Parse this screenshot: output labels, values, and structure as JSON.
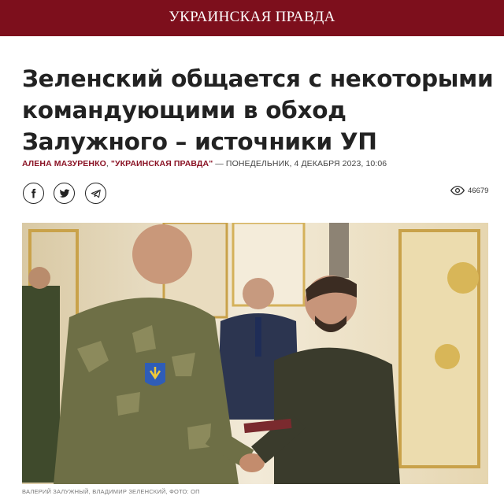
{
  "site": {
    "name": "УКРАИНСКАЯ ПРАВДА"
  },
  "article": {
    "title": "Зеленский общается с некоторыми командующими в обход Залужного – источники УП",
    "author": "АЛЕНА МАЗУРЕНКО",
    "source": "\"УКРАИНСКАЯ ПРАВДА\"",
    "separator": " — ",
    "date": "ПОНЕДЕЛЬНИК, 4 ДЕКАБРЯ 2023, 10:06",
    "views": "46679",
    "photo_caption": "ВАЛЕРИЙ ЗАЛУЖНЫЙ, ВЛАДИМИР ЗЕЛЕНСКИЙ, ФОТО: ОП"
  },
  "share": {
    "icons": [
      "facebook-icon",
      "twitter-icon",
      "telegram-icon"
    ]
  },
  "colors": {
    "header_bg": "#7d0f1c",
    "accent": "#8a1224",
    "text": "#222222"
  }
}
